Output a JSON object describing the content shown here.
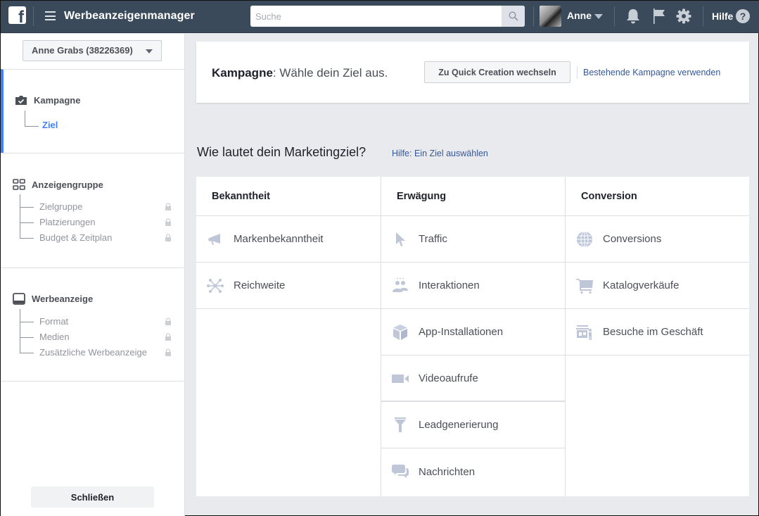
{
  "topbar": {
    "logo": "facebook-logo",
    "menu_icon": "hamburger-menu-icon",
    "app_title": "Werbeanzeigenmanager",
    "search": {
      "placeholder": "Suche",
      "value": "",
      "icon": "search-icon"
    },
    "user": {
      "name": "Anne",
      "avatar": "user-avatar"
    },
    "icons": [
      "notifications-bell-icon",
      "flag-icon",
      "settings-gear-icon"
    ],
    "help_label": "Hilfe",
    "help_icon": "?"
  },
  "sidebar": {
    "account_label": "Anne Grabs (38226369)",
    "sections": [
      {
        "title": "Kampagne",
        "icon": "briefcase-check-icon",
        "active": true,
        "items": [
          {
            "label": "Ziel",
            "locked": false,
            "current": true
          }
        ]
      },
      {
        "title": "Anzeigengruppe",
        "icon": "grid-icon",
        "active": false,
        "items": [
          {
            "label": "Zielgruppe",
            "locked": true
          },
          {
            "label": "Platzierungen",
            "locked": true
          },
          {
            "label": "Budget & Zeitplan",
            "locked": true
          }
        ]
      },
      {
        "title": "Werbeanzeige",
        "icon": "ad-monitor-icon",
        "active": false,
        "items": [
          {
            "label": "Format",
            "locked": true
          },
          {
            "label": "Medien",
            "locked": true
          },
          {
            "label": "Zusätzliche Werbeanzeige",
            "locked": true
          }
        ]
      }
    ],
    "close_label": "Schließen"
  },
  "header": {
    "title_bold": "Kampagne",
    "title_rest": ": Wähle dein Ziel aus.",
    "quick_creation_label": "Zu Quick Creation wechseln",
    "existing_campaign_link": "Bestehende Kampagne verwenden"
  },
  "objectives": {
    "question": "Wie lautet dein Marketingziel?",
    "help_link": "Hilfe: Ein Ziel auswählen",
    "icon_color": "#bec6d8",
    "columns": [
      {
        "title": "Bekanntheit",
        "items": [
          {
            "label": "Markenbekanntheit",
            "icon": "megaphone-icon"
          },
          {
            "label": "Reichweite",
            "icon": "network-reach-icon"
          }
        ]
      },
      {
        "title": "Erwägung",
        "items": [
          {
            "label": "Traffic",
            "icon": "cursor-icon"
          },
          {
            "label": "Interaktionen",
            "icon": "people-icon"
          },
          {
            "label": "App-Installationen",
            "icon": "box-icon"
          },
          {
            "label": "Videoaufrufe",
            "icon": "video-camera-icon"
          },
          {
            "label": "Leadgenerierung",
            "icon": "funnel-icon"
          },
          {
            "label": "Nachrichten",
            "icon": "chat-bubbles-icon"
          }
        ]
      },
      {
        "title": "Conversion",
        "items": [
          {
            "label": "Conversions",
            "icon": "globe-icon"
          },
          {
            "label": "Katalogverkäufe",
            "icon": "shopping-cart-icon"
          },
          {
            "label": "Besuche im Geschäft",
            "icon": "store-visit-icon"
          }
        ]
      }
    ]
  }
}
